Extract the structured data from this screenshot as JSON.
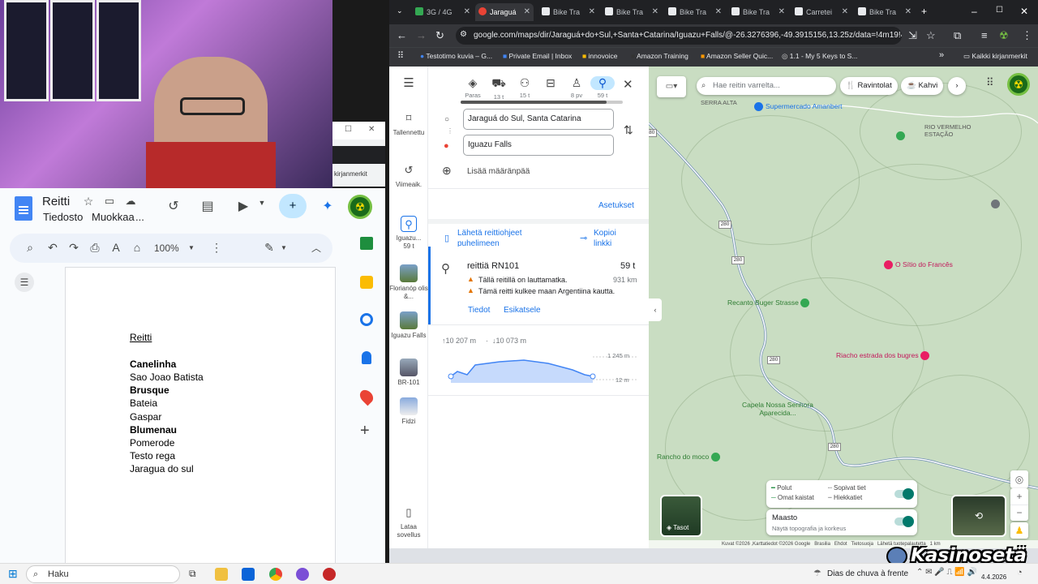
{
  "docs": {
    "title": "Reitti",
    "menu_file": "Tiedosto",
    "menu_edit": "Muokkaa",
    "menu_more": "...",
    "zoom": "100%",
    "behind_window_label": "kirjanmerkit",
    "content_lines": [
      {
        "text": "Reitti",
        "style": "underline"
      },
      {
        "text": "Canelinha",
        "style": "bold"
      },
      {
        "text": "Sao Joao Batista",
        "style": "normal"
      },
      {
        "text": "Brusque",
        "style": "bold"
      },
      {
        "text": "Bateia",
        "style": "normal"
      },
      {
        "text": "Gaspar",
        "style": "normal"
      },
      {
        "text": "Blumenau",
        "style": "bold"
      },
      {
        "text": "Pomerode",
        "style": "normal"
      },
      {
        "text": "Testo rega",
        "style": "normal"
      },
      {
        "text": "Jaragua do sul",
        "style": "normal"
      }
    ]
  },
  "chrome": {
    "tabs": [
      {
        "label": "3G / 4G",
        "active": false
      },
      {
        "label": "Jaraguá",
        "active": true
      },
      {
        "label": "Bike Tra",
        "active": false
      },
      {
        "label": "Bike Tra",
        "active": false
      },
      {
        "label": "Bike Tra",
        "active": false
      },
      {
        "label": "Bike Tra",
        "active": false
      },
      {
        "label": "Carretei",
        "active": false
      },
      {
        "label": "Bike Tra",
        "active": false
      }
    ],
    "url": "google.com/maps/dir/Jaraguá+do+Sul,+Santa+Catarina/Iguazu+Falls/@-26.3276396,-49.3915156,13.25z/data=!4m19!4m18!...",
    "bookmarks": [
      "Testotimo kuvia – G...",
      "Private Email | Inbox",
      "innovoice",
      "Amazon Training",
      "Amazon Seller Quic...",
      "1.1 - My 5 Keys to S..."
    ],
    "all_bookmarks": "Kaikki kirjanmerkit"
  },
  "maps": {
    "rail": {
      "saved": "Tallennettu",
      "recent": "Viimeaik.",
      "items": [
        {
          "label": "Iguazu...\n59 t"
        },
        {
          "label": "Florianóp olis &..."
        },
        {
          "label": "Iguazu Falls"
        },
        {
          "label": "BR-101"
        },
        {
          "label": "Fidzi"
        }
      ],
      "app": "Lataa sovellus"
    },
    "modes": [
      {
        "label": "Paras"
      },
      {
        "label": "13 t"
      },
      {
        "label": "15 t"
      },
      {
        "label": ""
      },
      {
        "label": "8 pv"
      },
      {
        "label": "59 t"
      }
    ],
    "origin": "Jaraguá do Sul, Santa Catarina",
    "destination": "Iguazu Falls",
    "add_destination": "Lisää määränpää",
    "settings": "Asetukset",
    "send_directions": "Lähetä reittiohjeet puhelimeen",
    "copy_link": "Kopioi linkki",
    "route": {
      "name": "reittiä RN101",
      "time": "59 t",
      "distance": "931 km",
      "warning1": "Tällä reitillä on lauttamatka.",
      "warning2": "Tämä reitti kulkee maan Argentiina kautta.",
      "details": "Tiedot",
      "preview": "Esikatsele"
    },
    "elevation": {
      "up": "↑10 207 m",
      "down": "↓10 073 m",
      "max": "1 245 m",
      "min": "12 m"
    },
    "search_placeholder": "Hae reitin varrelta...",
    "chips": [
      "Ravintolat",
      "Kahvi"
    ],
    "places": [
      {
        "name": "Supermercado Amanbert"
      },
      {
        "name": "O Sítio do Francês"
      },
      {
        "name": "Recanto Buger Strasse"
      },
      {
        "name": "Riacho estrada dos bugres"
      },
      {
        "name": "Capela Nossa Senhora Aparecida..."
      },
      {
        "name": "Rancho do moco"
      },
      {
        "name": "SERRA ALTA"
      },
      {
        "name": "RIO VERMELHO ESTAÇÃO"
      }
    ],
    "road_number": "280",
    "legend": {
      "paths": "Polut",
      "own_lanes": "Omat kaistat",
      "suitable_roads": "Sopivat tiet",
      "gravel": "Hiekkatiet"
    },
    "terrain": {
      "title": "Maasto",
      "subtitle": "Näytä topografia ja korkeus"
    },
    "layers": "Tasot",
    "attribution": "Kuvat ©2026 ,Karttatiedot ©2026 Google   Brasilia   Ehdot   Tietosuoja   Lähetä tuotepalautetta   1 km"
  },
  "taskbar": {
    "search": "Haku",
    "weather": "Dias de chuva à frente",
    "date": "4.4.2026"
  },
  "watermark": "Kasinosetä"
}
